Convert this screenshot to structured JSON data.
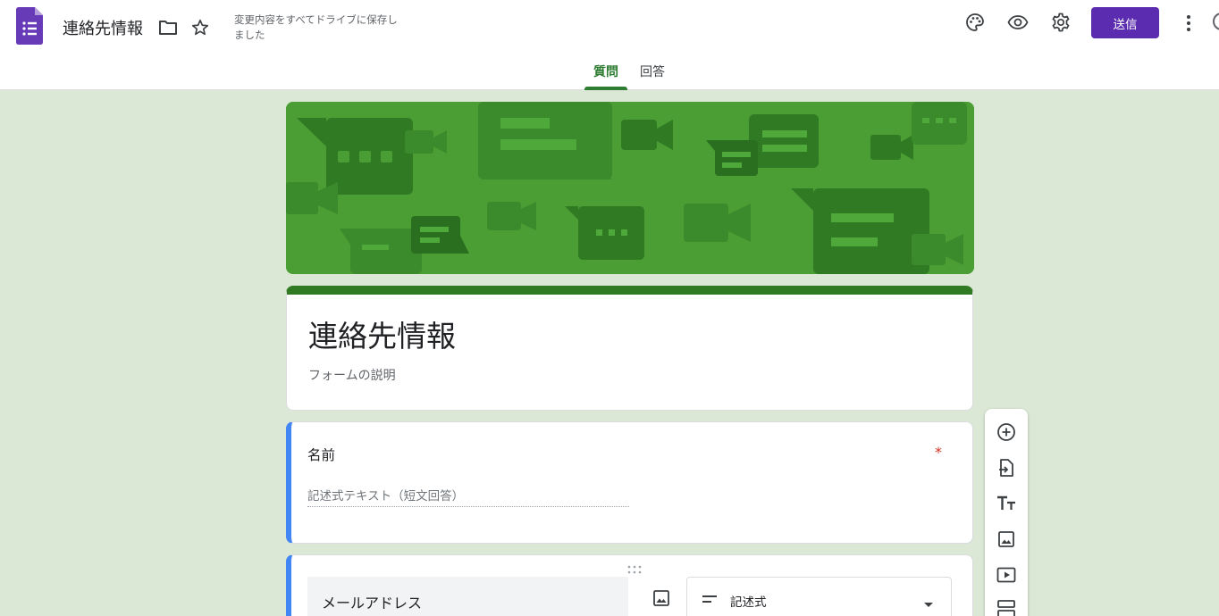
{
  "header": {
    "doc_title": "連絡先情報",
    "save_status": "変更内容をすべてドライブに保存しました",
    "send_label": "送信"
  },
  "tabs": [
    {
      "label": "質問",
      "active": true
    },
    {
      "label": "回答",
      "active": false
    }
  ],
  "form": {
    "title": "連絡先情報",
    "description": "フォームの説明"
  },
  "questions": [
    {
      "title": "名前",
      "required_mark": "*",
      "answer_placeholder": "記述式テキスト（短文回答）"
    },
    {
      "title": "メールアドレス",
      "type_label": "記述式"
    }
  ],
  "icons": {
    "app_logo": "forms-logo-icon",
    "folder": "folder-icon",
    "star": "star-icon",
    "palette": "palette-icon",
    "preview": "eye-icon",
    "settings": "gear-icon",
    "more": "more-vert-icon"
  },
  "colors": {
    "brand_purple": "#5b2bb0",
    "theme_green": "#2f7a23",
    "banner_green": "#4a9e34",
    "background": "#dce8d6",
    "active_question": "#4285f4",
    "required": "#d93025"
  }
}
